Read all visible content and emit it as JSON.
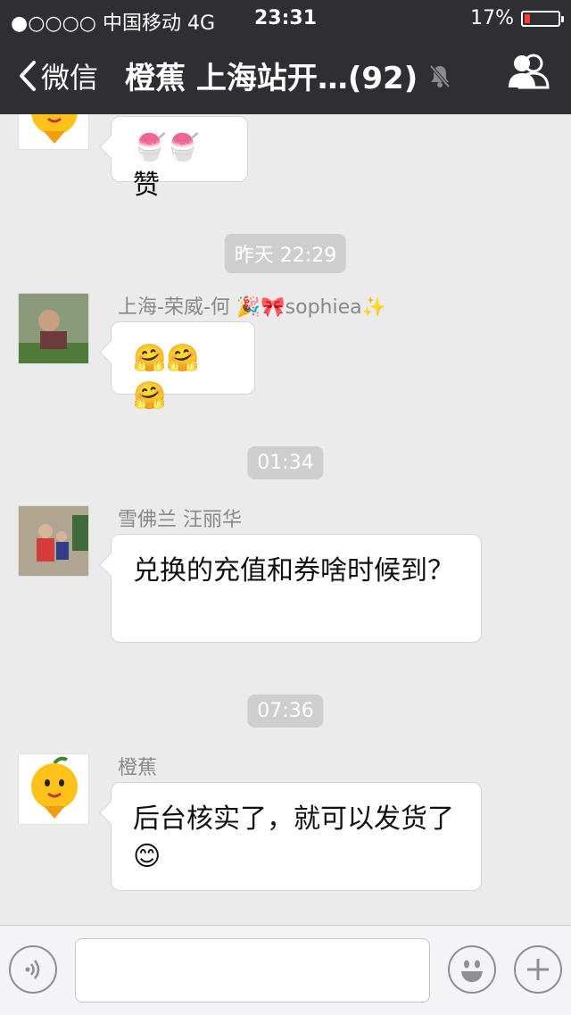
{
  "status_bar": {
    "carrier": "●○○○○ 中国移动  4G",
    "time": "23:31",
    "battery_percent": "17%",
    "battery_level": 0.17
  },
  "nav": {
    "back_label": "微信",
    "title": "橙蕉 上海站开…(92)"
  },
  "chat": {
    "messages": [
      {
        "sender": "",
        "text": "赞",
        "emoji": "🍧🍧"
      },
      {
        "sender": "上海-荣威-何 🎉🎀sophiea✨",
        "text": "🤗🤗🤗"
      },
      {
        "sender": "雪佛兰 汪丽华",
        "text": "兑换的充值和券啥时候到？"
      },
      {
        "sender": "橙蕉",
        "text": "后台核实了，就可以发货了😊"
      }
    ],
    "timestamps": [
      "昨天 22:29",
      "01:34",
      "07:36"
    ]
  },
  "colors": {
    "nav_bg": "#2f2f33",
    "chat_bg": "#ebebeb",
    "battery_low": "#ff3b30"
  },
  "icons": [
    "back-chevron-icon",
    "mute-bell-icon",
    "group-members-icon",
    "voice-icon",
    "emoji-icon",
    "plus-icon"
  ]
}
